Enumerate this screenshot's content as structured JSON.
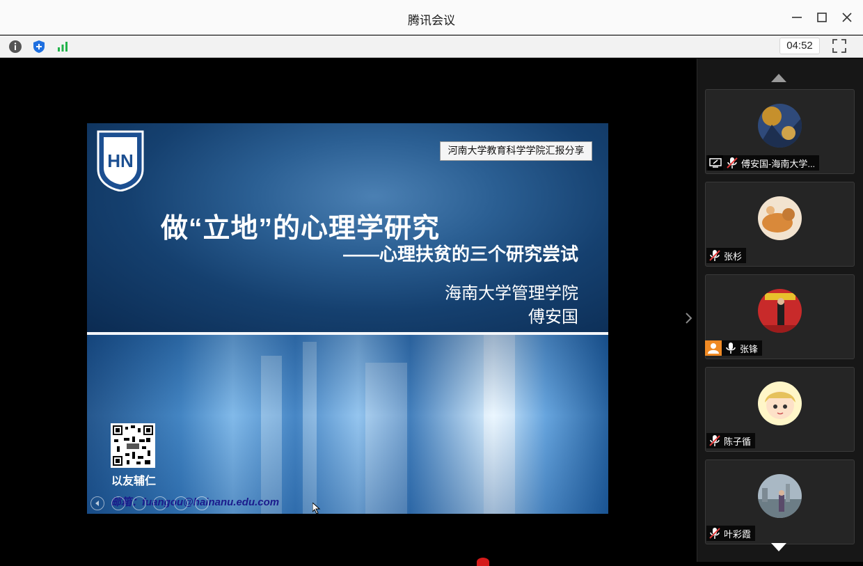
{
  "window": {
    "title": "腾讯会议",
    "controls": [
      "minimize-icon",
      "maximize-icon",
      "close-icon"
    ]
  },
  "toolbar": {
    "icons": [
      "info-icon",
      "shield-icon",
      "signal-icon"
    ],
    "timer": "04:52",
    "fullscreen_icon": "fullscreen-icon"
  },
  "slide": {
    "banner": "河南大学教育科学学院汇报分享",
    "title": "做“立地”的心理学研究",
    "subtitle": "——心理扶贫的三个研究尝试",
    "organization": "海南大学管理学院",
    "author": "傅安国",
    "qr_label": "以友辅仁",
    "email": "邮箱：fuangou@hainanu.edu.com",
    "logo_text": "HN",
    "colors": {
      "top": "#15406f",
      "bottom": "#3a7fc0",
      "banner_bg": "#f5f5f5"
    }
  },
  "participants": [
    {
      "name": "傅安国-海南大学...",
      "muted": true,
      "sharing": true,
      "host": false
    },
    {
      "name": "张杉",
      "muted": true,
      "sharing": false,
      "host": false
    },
    {
      "name": "张锋",
      "muted": false,
      "sharing": false,
      "host": true
    },
    {
      "name": "陈子循",
      "muted": true,
      "sharing": false,
      "host": false
    },
    {
      "name": "叶彩霞",
      "muted": true,
      "sharing": false,
      "host": false
    }
  ]
}
